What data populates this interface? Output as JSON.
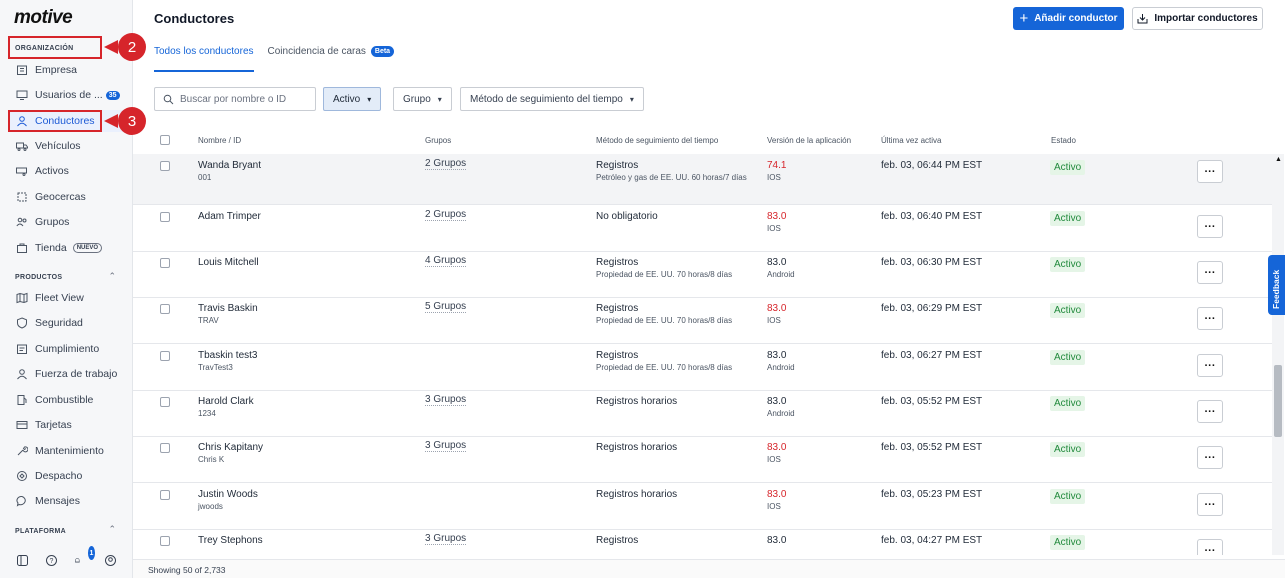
{
  "logo": "motive",
  "sidebar": {
    "org_label": "ORGANIZACIÓN",
    "products_label": "PRODUCTOS",
    "platform_label": "PLATAFORMA",
    "org_items": [
      {
        "label": "Empresa"
      },
      {
        "label": "Usuarios de ...",
        "badge": "35"
      },
      {
        "label": "Conductores"
      },
      {
        "label": "Vehículos"
      },
      {
        "label": "Activos"
      },
      {
        "label": "Geocercas"
      },
      {
        "label": "Grupos"
      },
      {
        "label": "Tienda",
        "badge": "NUEVO"
      }
    ],
    "product_items": [
      {
        "label": "Fleet View"
      },
      {
        "label": "Seguridad"
      },
      {
        "label": "Cumplimiento"
      },
      {
        "label": "Fuerza de trabajo"
      },
      {
        "label": "Combustible"
      },
      {
        "label": "Tarjetas"
      },
      {
        "label": "Mantenimiento"
      },
      {
        "label": "Despacho"
      },
      {
        "label": "Mensajes"
      }
    ],
    "notification_count": "1"
  },
  "callouts": {
    "step2": "2",
    "step3": "3",
    "color": "#d6252b"
  },
  "header": {
    "title": "Conductores",
    "add_driver": "Añadir conductor",
    "import_drivers": "Importar conductores"
  },
  "tabs": {
    "all": "Todos los conductores",
    "faces": "Coincidencia de caras",
    "beta": "Beta"
  },
  "filters": {
    "search_placeholder": "Buscar por nombre o ID",
    "status": "Activo",
    "group": "Grupo",
    "method": "Método de seguimiento del tiempo"
  },
  "table": {
    "headers": {
      "name": "Nombre / ID",
      "groups": "Grupos",
      "method": "Método de seguimiento del tiempo",
      "version": "Versión de la aplicación",
      "last_active": "Última vez activa",
      "status": "Estado"
    },
    "rows": [
      {
        "name": "Wanda Bryant",
        "id": "001",
        "groups": "2 Grupos",
        "method": "Registros",
        "method_sub": "Petróleo y gas de EE. UU. 60 horas/7 días",
        "version": "74.1",
        "os": "IOS",
        "outdated": true,
        "last_active": "feb. 03, 06:44 PM EST",
        "status": "Activo"
      },
      {
        "name": "Adam Trimper",
        "id": "",
        "groups": "2 Grupos",
        "method": "No obligatorio",
        "method_sub": "",
        "version": "83.0",
        "os": "IOS",
        "outdated": true,
        "last_active": "feb. 03, 06:40 PM EST",
        "status": "Activo"
      },
      {
        "name": "Louis Mitchell",
        "id": "",
        "groups": "4 Grupos",
        "method": "Registros",
        "method_sub": "Propiedad de EE. UU. 70 horas/8 días",
        "version": "83.0",
        "os": "Android",
        "outdated": false,
        "last_active": "feb. 03, 06:30 PM EST",
        "status": "Activo"
      },
      {
        "name": "Travis Baskin",
        "id": "TRAV",
        "groups": "5 Grupos",
        "method": "Registros",
        "method_sub": "Propiedad de EE. UU. 70 horas/8 días",
        "version": "83.0",
        "os": "IOS",
        "outdated": true,
        "last_active": "feb. 03, 06:29 PM EST",
        "status": "Activo"
      },
      {
        "name": "Tbaskin test3",
        "id": "TravTest3",
        "groups": "",
        "method": "Registros",
        "method_sub": "Propiedad de EE. UU. 70 horas/8 días",
        "version": "83.0",
        "os": "Android",
        "outdated": false,
        "last_active": "feb. 03, 06:27 PM EST",
        "status": "Activo"
      },
      {
        "name": "Harold Clark",
        "id": "1234",
        "groups": "3 Grupos",
        "method": "Registros horarios",
        "method_sub": "",
        "version": "83.0",
        "os": "Android",
        "outdated": false,
        "last_active": "feb. 03, 05:52 PM EST",
        "status": "Activo"
      },
      {
        "name": "Chris Kapitany",
        "id": "Chris K",
        "groups": "3 Grupos",
        "method": "Registros horarios",
        "method_sub": "",
        "version": "83.0",
        "os": "IOS",
        "outdated": true,
        "last_active": "feb. 03, 05:52 PM EST",
        "status": "Activo"
      },
      {
        "name": "Justin Woods",
        "id": "jwoods",
        "groups": "",
        "method": "Registros horarios",
        "method_sub": "",
        "version": "83.0",
        "os": "IOS",
        "outdated": true,
        "last_active": "feb. 03, 05:23 PM EST",
        "status": "Activo"
      },
      {
        "name": "Trey Stephons",
        "id": "",
        "groups": "3 Grupos",
        "method": "Registros",
        "method_sub": "",
        "version": "83.0",
        "os": "",
        "outdated": false,
        "last_active": "feb. 03, 04:27 PM EST",
        "status": "Activo"
      }
    ],
    "more_label": "···"
  },
  "feedback": "Feedback",
  "footer": "Showing 50 of 2,733"
}
